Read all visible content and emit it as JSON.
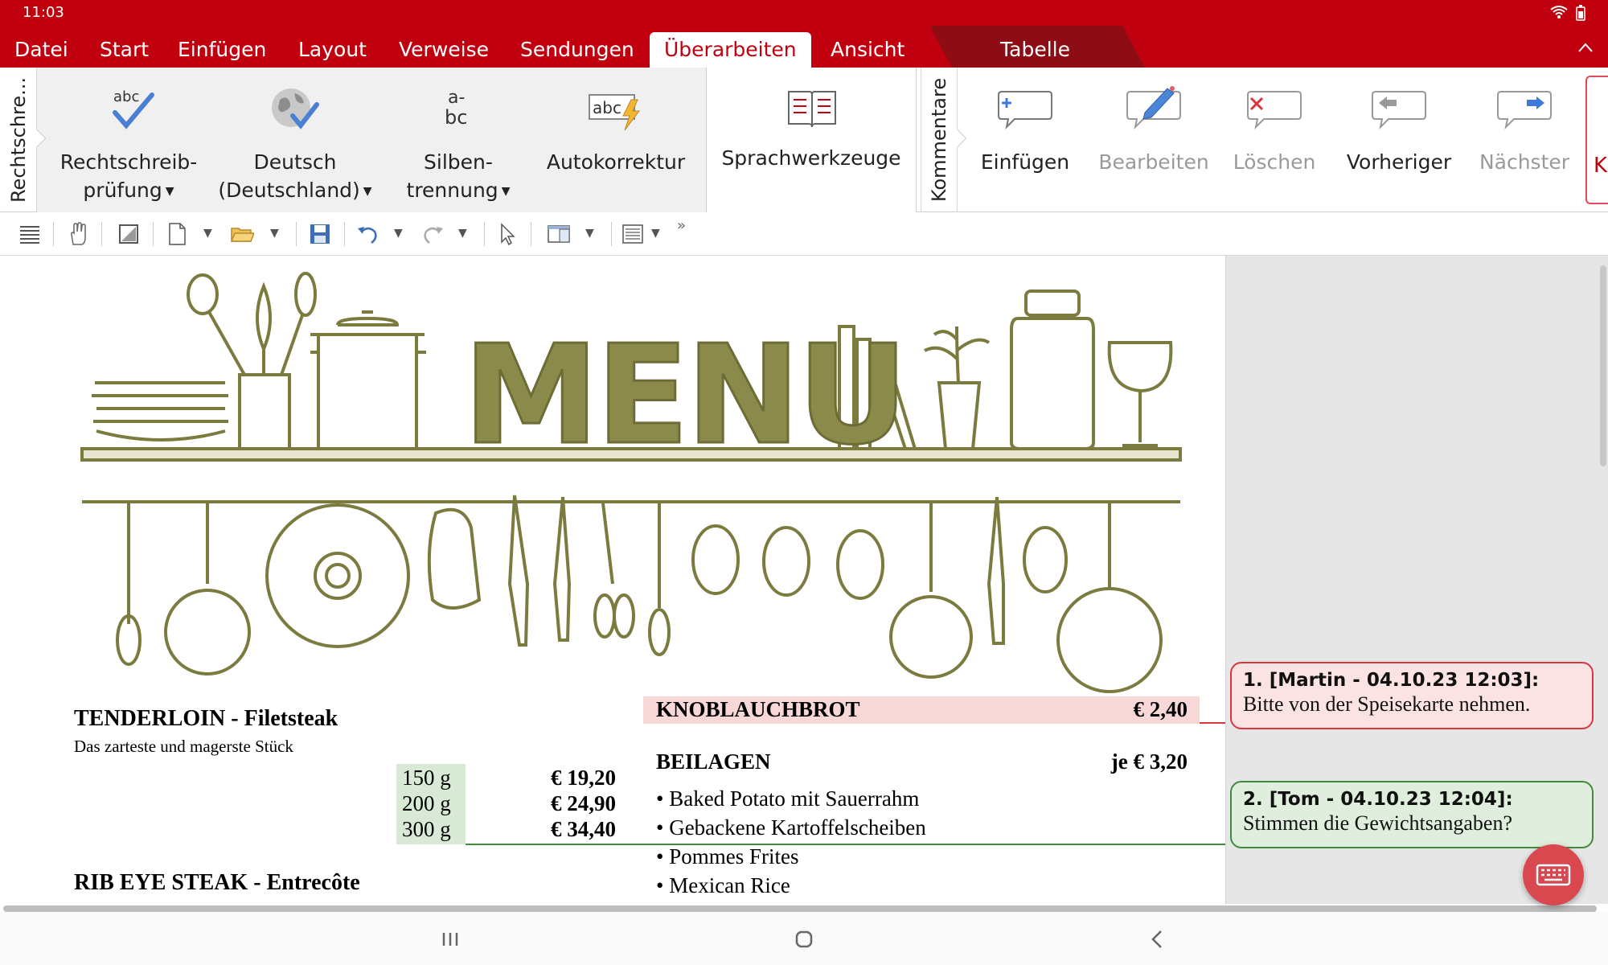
{
  "status": {
    "time": "11:03"
  },
  "menubar": {
    "items": [
      "Datei",
      "Start",
      "Einfügen",
      "Layout",
      "Verweise",
      "Sendungen",
      "Überarbeiten",
      "Ansicht"
    ],
    "active": "Überarbeiten",
    "context_tab": "Tabelle"
  },
  "ribbon": {
    "group_rechtschreibung_label": "Rechtschre...",
    "rechtschreib_line1": "Rechtschreib-",
    "rechtschreib_line2": "prüfung",
    "deutsch_line1": "Deutsch",
    "deutsch_line2": "(Deutschland)",
    "silben_line1": "Silben-",
    "silben_line2": "trennung",
    "silben_icon_text_top": "a-",
    "silben_icon_text_bottom": "bc",
    "abc_icon_text": "abc",
    "autokorrektur": "Autokorrektur",
    "sprachwerkzeuge": "Sprachwerkzeuge",
    "group_kommentare_label": "Kommentare",
    "einfuegen": "Einfügen",
    "bearbeiten": "Bearbeiten",
    "loeschen": "Löschen",
    "vorheriger": "Vorheriger",
    "naechster": "Nächster",
    "cut_off_label": "K"
  },
  "document": {
    "menu_heading": "MENU",
    "tenderloin": {
      "title": "TENDERLOIN - Filetsteak",
      "desc": "Das zarteste und magerste Stück",
      "weights": [
        "150 g",
        "200 g",
        "300 g"
      ],
      "prices": [
        "€ 19,20",
        "€ 24,90",
        "€ 34,40"
      ]
    },
    "ribeye": {
      "title": "RIB EYE STEAK - Entrecôte"
    },
    "knoblauchbrot": {
      "title": "KNOBLAUCHBROT",
      "price": "€ 2,40"
    },
    "beilagen": {
      "title": "BEILAGEN",
      "price": "je € 3,20",
      "items": [
        "• Baked Potato mit Sauerrahm",
        "• Gebackene Kartoffelscheiben",
        "• Pommes Frites",
        "• Mexican Rice"
      ]
    }
  },
  "comments": [
    {
      "head": "1. [Martin - 04.10.23 12:03]:",
      "body": "Bitte von der Speisekarte nehmen.",
      "color": "#d9363e"
    },
    {
      "head": "2. [Tom - 04.10.23 12:04]:",
      "body": "Stimmen die Gewichtsangaben?",
      "color": "#3f8a3c"
    }
  ],
  "colors": {
    "brand": "#c0000f",
    "art_olive": "#7b7a3f",
    "knob_highlight": "#f8d7d7",
    "weights_highlight": "#d8ead6"
  }
}
